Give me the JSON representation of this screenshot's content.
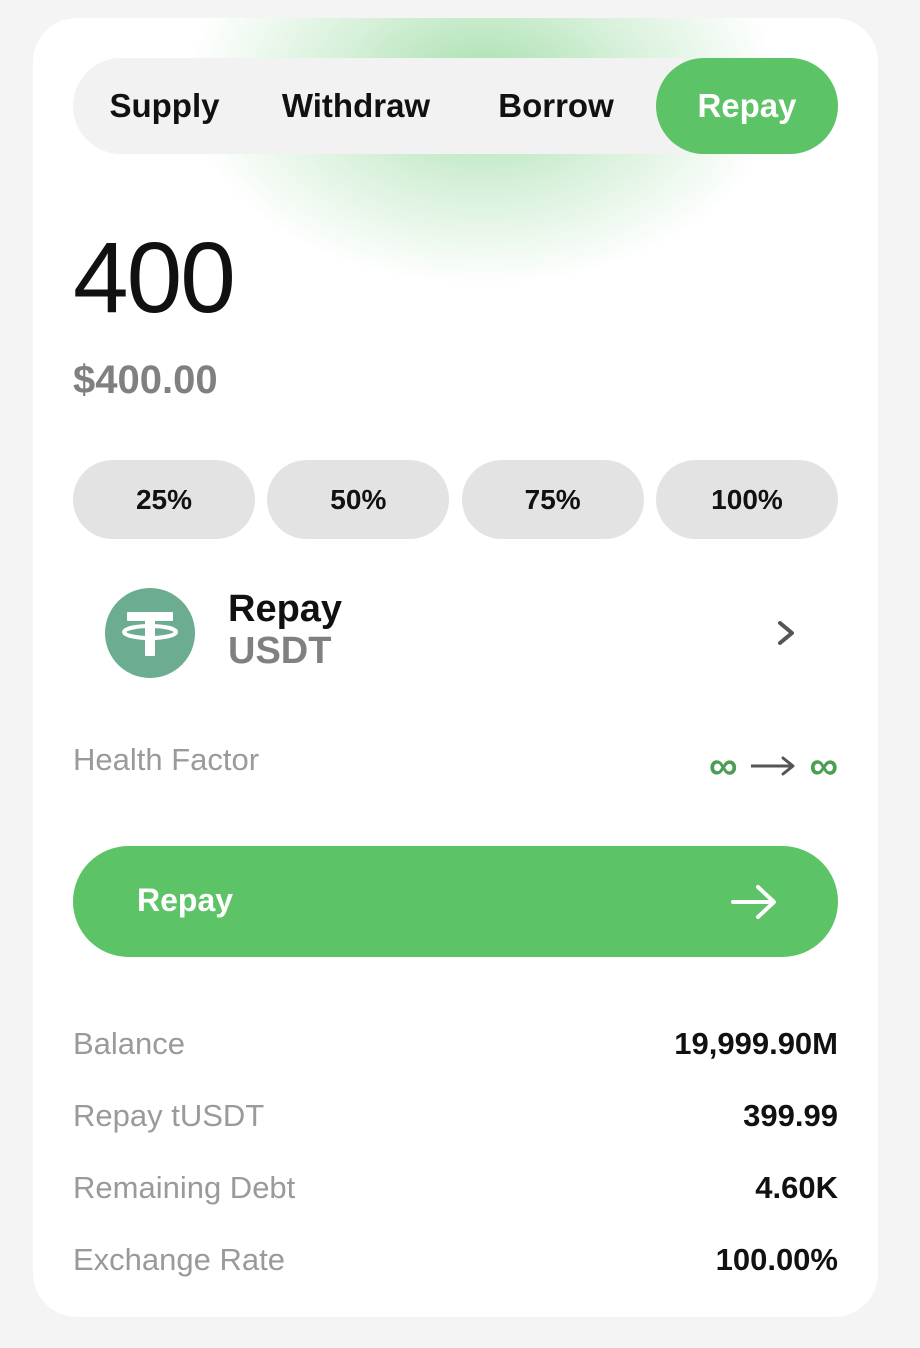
{
  "tabs": [
    {
      "label": "Supply",
      "active": false
    },
    {
      "label": "Withdraw",
      "active": false
    },
    {
      "label": "Borrow",
      "active": false
    },
    {
      "label": "Repay",
      "active": true
    }
  ],
  "amount": {
    "value": "400",
    "usd_value": "$400.00"
  },
  "percent_buttons": [
    "25%",
    "50%",
    "75%",
    "100%"
  ],
  "asset": {
    "action": "Repay",
    "symbol": "USDT",
    "icon": "tether-icon",
    "icon_color": "#6cac90"
  },
  "health_factor": {
    "label": "Health Factor",
    "from": "∞",
    "to": "∞"
  },
  "cta": {
    "label": "Repay",
    "color": "#5cc466"
  },
  "info_rows": [
    {
      "label": "Balance",
      "value": "19,999.90M"
    },
    {
      "label": "Repay tUSDT",
      "value": "399.99"
    },
    {
      "label": "Remaining Debt",
      "value": "4.60K"
    },
    {
      "label": "Exchange Rate",
      "value": "100.00%"
    }
  ]
}
